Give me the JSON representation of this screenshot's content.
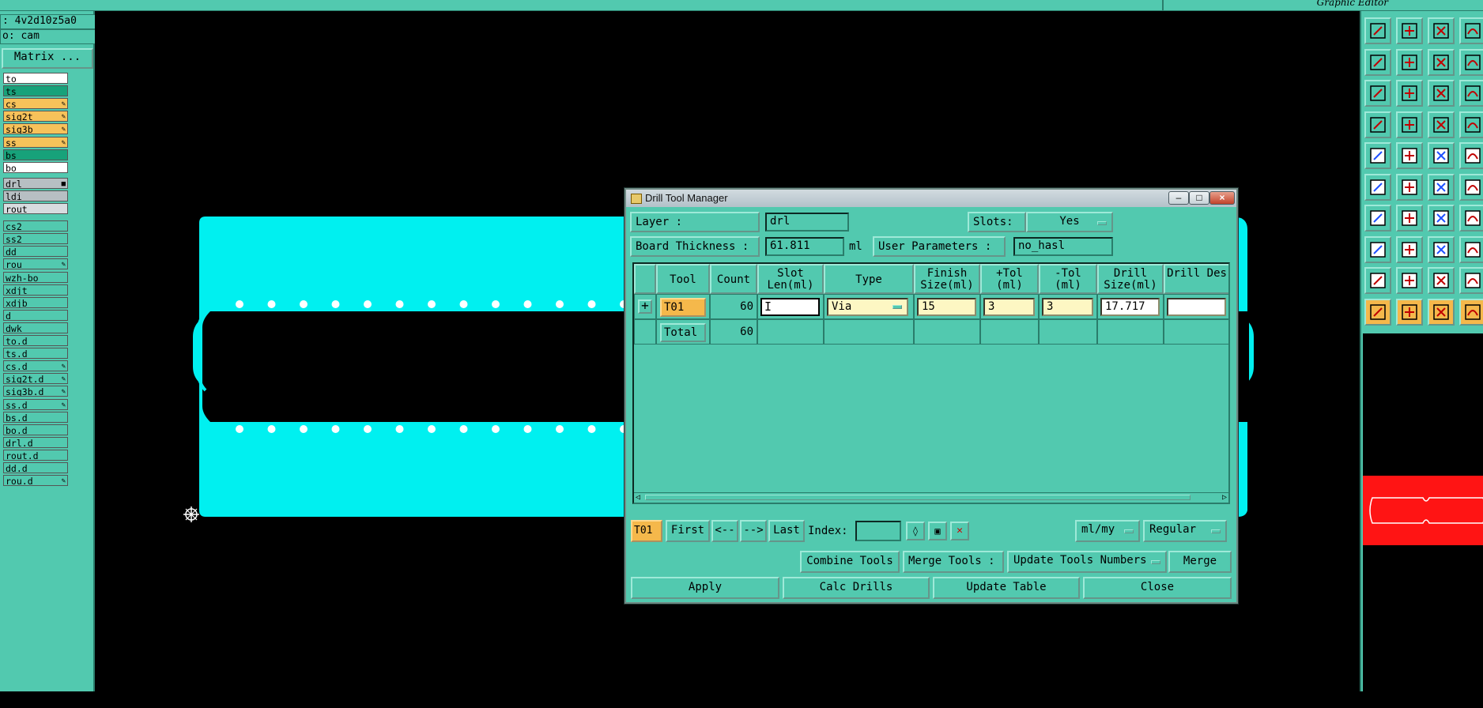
{
  "topbar": {
    "editor_title": "Graphic Editor"
  },
  "left_panel": {
    "job_field": ": 4v2d10z5a0",
    "step_field": "o: cam",
    "matrix_button": "Matrix ...",
    "layers": [
      {
        "name": "to",
        "bg": "#ffffff",
        "mark": ""
      },
      {
        "name": "ts",
        "bg": "#17a27a",
        "mark": ""
      },
      {
        "name": "cs",
        "bg": "#f7c25a",
        "mark": "✎"
      },
      {
        "name": "sig2t",
        "bg": "#f7c25a",
        "mark": "✎"
      },
      {
        "name": "sig3b",
        "bg": "#f7c25a",
        "mark": "✎"
      },
      {
        "name": "ss",
        "bg": "#f7c25a",
        "mark": "✎"
      },
      {
        "name": "bs",
        "bg": "#17a27a",
        "mark": ""
      },
      {
        "name": "bo",
        "bg": "#ffffff",
        "mark": ""
      },
      {
        "name": "drl",
        "bg": "#b7bfc3",
        "mark": "■"
      },
      {
        "name": "ldi",
        "bg": "#b7bfc3",
        "mark": ""
      },
      {
        "name": "rout",
        "bg": "#d7dcdf",
        "mark": ""
      },
      {
        "name": "cs2",
        "bg": "#52c9af",
        "mark": ""
      },
      {
        "name": "ss2",
        "bg": "#52c9af",
        "mark": ""
      },
      {
        "name": "dd",
        "bg": "#52c9af",
        "mark": ""
      },
      {
        "name": "rou",
        "bg": "#52c9af",
        "mark": "✎"
      },
      {
        "name": "wzh-bo",
        "bg": "#52c9af",
        "mark": ""
      },
      {
        "name": "xdjt",
        "bg": "#52c9af",
        "mark": ""
      },
      {
        "name": "xdjb",
        "bg": "#52c9af",
        "mark": ""
      },
      {
        "name": "d",
        "bg": "#52c9af",
        "mark": ""
      },
      {
        "name": "dwk",
        "bg": "#52c9af",
        "mark": ""
      },
      {
        "name": "to.d",
        "bg": "#52c9af",
        "mark": ""
      },
      {
        "name": "ts.d",
        "bg": "#52c9af",
        "mark": ""
      },
      {
        "name": "cs.d",
        "bg": "#52c9af",
        "mark": "✎"
      },
      {
        "name": "sig2t.d",
        "bg": "#52c9af",
        "mark": "✎"
      },
      {
        "name": "sig3b.d",
        "bg": "#52c9af",
        "mark": "✎"
      },
      {
        "name": "ss.d",
        "bg": "#52c9af",
        "mark": "✎"
      },
      {
        "name": "bs.d",
        "bg": "#52c9af",
        "mark": ""
      },
      {
        "name": "bo.d",
        "bg": "#52c9af",
        "mark": ""
      },
      {
        "name": "drl.d",
        "bg": "#52c9af",
        "mark": ""
      },
      {
        "name": "rout.d",
        "bg": "#52c9af",
        "mark": ""
      },
      {
        "name": "dd.d",
        "bg": "#52c9af",
        "mark": ""
      },
      {
        "name": "rou.d",
        "bg": "#52c9af",
        "mark": "✎"
      }
    ]
  },
  "dialog": {
    "title": "Drill Tool Manager",
    "layer_label": "Layer :",
    "layer_value": "drl",
    "slots_label": "Slots:",
    "slots_value": "Yes",
    "board_thickness_label": "Board Thickness :",
    "board_thickness_value": "61.811",
    "board_thickness_unit": "ml",
    "user_params_label": "User Parameters :",
    "user_params_value": "no_hasl",
    "headers": [
      "",
      "Tool",
      "Count",
      "Slot Len(ml)",
      "Type",
      "Finish Size(ml)",
      "+Tol (ml)",
      "-Tol (ml)",
      "Drill Size(ml)",
      "Drill Des"
    ],
    "row": {
      "tool": "T01",
      "count": "60",
      "slot_len": "",
      "type": "Via",
      "finish_size": "15",
      "plus_tol": "3",
      "minus_tol": "3",
      "drill_size": "17.717",
      "drill_des": ""
    },
    "total": {
      "label": "Total",
      "count": "60"
    },
    "nav": {
      "current_tool": "T01",
      "first": "First",
      "prev": "<--",
      "next": "-->",
      "last": "Last",
      "index_label": "Index:",
      "index_value": "",
      "units": "ml/my",
      "mode": "Regular"
    },
    "merge_row": {
      "combine": "Combine Tools",
      "merge_tools_label": "Merge Tools :",
      "merge_option": "Update Tools Numbers",
      "merge": "Merge"
    },
    "actions": {
      "apply": "Apply",
      "calc": "Calc Drills",
      "update": "Update Table",
      "close": "Close"
    }
  },
  "colors": {
    "panel": "#52c9af",
    "board": "#00f0f0",
    "tool_tag": "#f5b84b",
    "input_yellow": "#fdf7c3",
    "minimap_red": "#ff1414"
  }
}
